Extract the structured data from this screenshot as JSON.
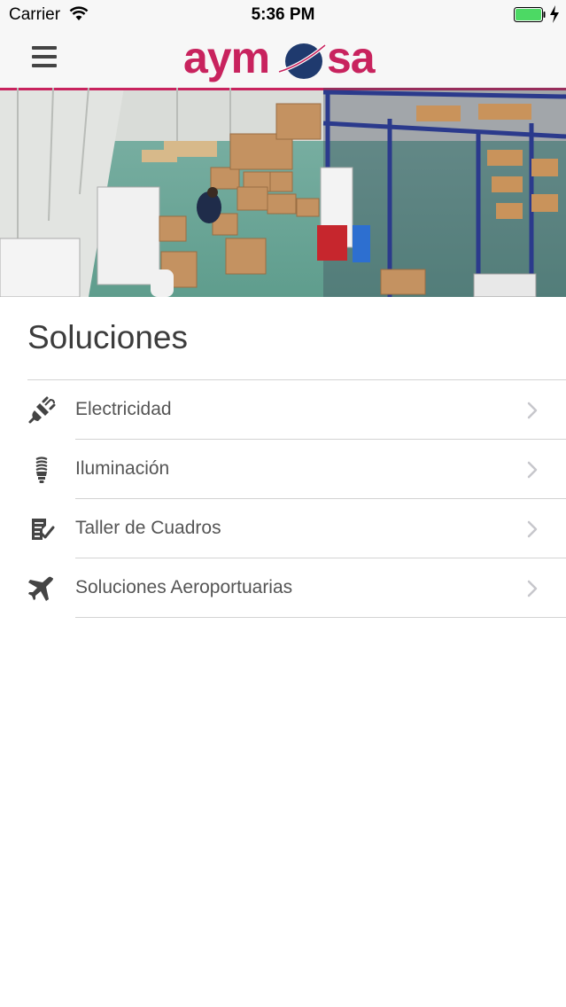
{
  "status_bar": {
    "carrier": "Carrier",
    "time": "5:36 PM",
    "battery_color": "#4cd964"
  },
  "navbar": {
    "menu_icon": "hamburger-menu-icon",
    "logo_text_left": "aym",
    "logo_text_right": "sa",
    "logo_color": "#c8235e",
    "logo_globe_color": "#1f3a6e"
  },
  "section": {
    "title": "Soluciones"
  },
  "items": [
    {
      "label": "Electricidad",
      "icon": "plug-icon"
    },
    {
      "label": "Iluminación",
      "icon": "lightbulb-icon"
    },
    {
      "label": "Taller de Cuadros",
      "icon": "checklist-icon"
    },
    {
      "label": "Soluciones Aeroportuarias",
      "icon": "airplane-icon"
    }
  ]
}
